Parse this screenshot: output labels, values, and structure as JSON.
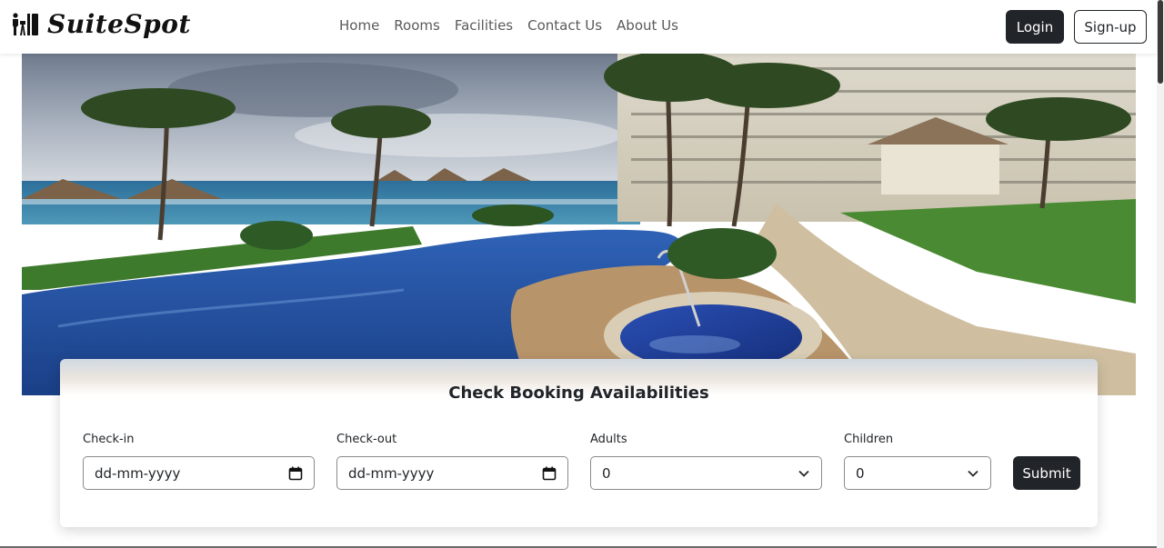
{
  "brand": {
    "name": "SuiteSpot",
    "icon": "hotel-people-icon"
  },
  "nav": {
    "links": [
      "Home",
      "Rooms",
      "Facilities",
      "Contact Us",
      "About Us"
    ]
  },
  "auth": {
    "login_label": "Login",
    "signup_label": "Sign-up"
  },
  "hero": {
    "image": "resort-pool-palm-trees"
  },
  "booking": {
    "title": "Check Booking Availabilities",
    "checkin": {
      "label": "Check-in",
      "value": "dd-mm-yyyy",
      "icon": "calendar-icon"
    },
    "checkout": {
      "label": "Check-out",
      "value": "dd-mm-yyyy",
      "icon": "calendar-icon"
    },
    "adults": {
      "label": "Adults",
      "value": "0",
      "icon": "chevron-down-icon"
    },
    "children": {
      "label": "Children",
      "value": "0",
      "icon": "chevron-down-icon"
    },
    "submit_label": "Submit"
  },
  "colors": {
    "dark": "#212529",
    "nav_text": "#5a5a5a"
  }
}
